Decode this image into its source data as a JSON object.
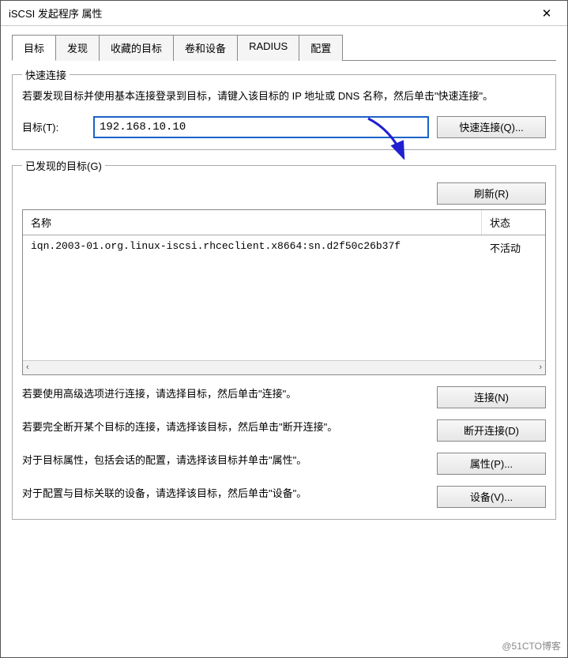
{
  "titlebar": {
    "title": "iSCSI 发起程序 属性"
  },
  "tabs": {
    "items": [
      {
        "label": "目标",
        "active": true
      },
      {
        "label": "发现"
      },
      {
        "label": "收藏的目标"
      },
      {
        "label": "卷和设备"
      },
      {
        "label": "RADIUS"
      },
      {
        "label": "配置"
      }
    ]
  },
  "quickConnect": {
    "legend": "快速连接",
    "description": "若要发现目标并使用基本连接登录到目标，请键入该目标的 IP 地址或 DNS 名称，然后单击\"快速连接\"。",
    "targetLabel": "目标(T):",
    "targetValue": "192.168.10.10",
    "button": "快速连接(Q)..."
  },
  "discovered": {
    "legend": "已发现的目标(G)",
    "refreshButton": "刷新(R)",
    "columns": {
      "name": "名称",
      "state": "状态"
    },
    "rows": [
      {
        "name": "iqn.2003-01.org.linux-iscsi.rhceclient.x8664:sn.d2f50c26b37f",
        "state": "不活动"
      }
    ],
    "actions": {
      "connect": {
        "text": "若要使用高级选项进行连接，请选择目标，然后单击\"连接\"。",
        "button": "连接(N)"
      },
      "disconnect": {
        "text": "若要完全断开某个目标的连接，请选择该目标，然后单击\"断开连接\"。",
        "button": "断开连接(D)"
      },
      "properties": {
        "text": "对于目标属性，包括会话的配置，请选择该目标并单击\"属性\"。",
        "button": "属性(P)..."
      },
      "devices": {
        "text": "对于配置与目标关联的设备，请选择该目标，然后单击\"设备\"。",
        "button": "设备(V)..."
      }
    }
  },
  "watermark": "@51CTO博客"
}
